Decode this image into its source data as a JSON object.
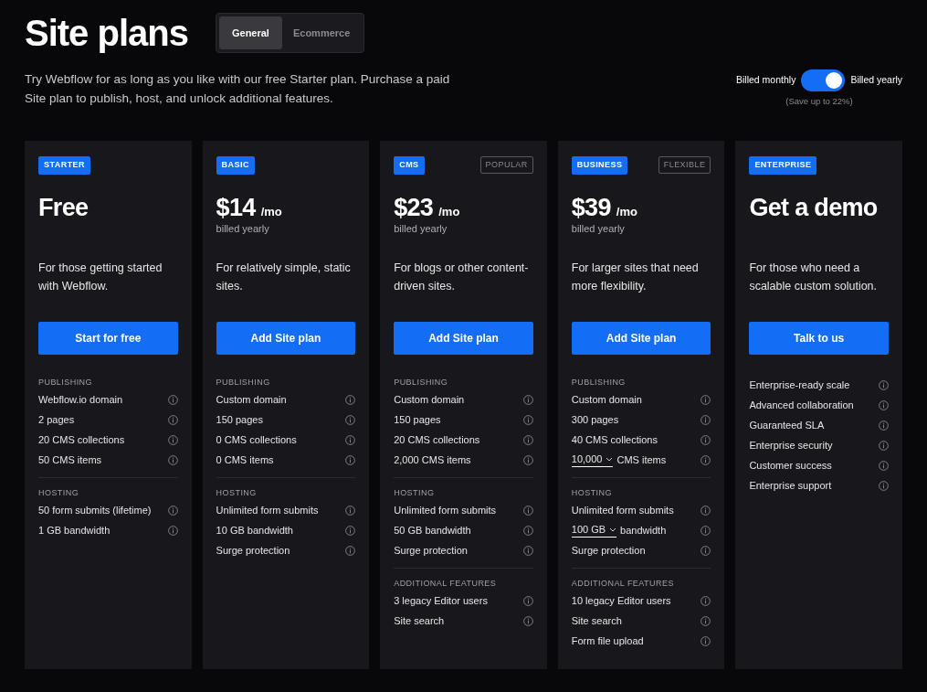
{
  "title": "Site plans",
  "tabs": [
    {
      "label": "General",
      "selected": true
    },
    {
      "label": "Ecommerce",
      "selected": false
    }
  ],
  "intro": "Try Webflow for as long as you like with our free Starter plan. Purchase a paid Site plan to publish, host, and unlock additional features.",
  "billing": {
    "left_label": "Billed monthly",
    "right_label": "Billed yearly",
    "on": true,
    "note": "(Save up to 22%)"
  },
  "plans": [
    {
      "tag": "STARTER",
      "price": "Free",
      "description": "For those getting started with Webflow.",
      "button": "Start for free",
      "sections": [
        {
          "heading": "PUBLISHING",
          "items": [
            {
              "kind": "text",
              "label": "Webflow.io domain"
            },
            {
              "kind": "text",
              "label": "2 pages"
            },
            {
              "kind": "text",
              "label": "20 CMS collections"
            },
            {
              "kind": "text",
              "label": "50 CMS items"
            }
          ]
        },
        {
          "heading": "HOSTING",
          "items": [
            {
              "kind": "text",
              "label": "50 form submits (lifetime)"
            },
            {
              "kind": "text",
              "label": "1 GB bandwidth"
            }
          ]
        }
      ]
    },
    {
      "tag": "BASIC",
      "price": "$14",
      "period": "/mo",
      "billing_note": "billed yearly",
      "description": "For relatively simple, static sites.",
      "button": "Add Site plan",
      "sections": [
        {
          "heading": "PUBLISHING",
          "items": [
            {
              "kind": "text",
              "label": "Custom domain"
            },
            {
              "kind": "text",
              "label": "150 pages"
            },
            {
              "kind": "text",
              "label": "0 CMS collections"
            },
            {
              "kind": "text",
              "label": "0 CMS items"
            }
          ]
        },
        {
          "heading": "HOSTING",
          "items": [
            {
              "kind": "text",
              "label": "Unlimited form submits"
            },
            {
              "kind": "text",
              "label": "10 GB bandwidth"
            },
            {
              "kind": "text",
              "label": "Surge protection"
            }
          ]
        }
      ]
    },
    {
      "tag": "CMS",
      "badge": "POPULAR",
      "price": "$23",
      "period": "/mo",
      "billing_note": "billed yearly",
      "description": "For blogs or other content-driven sites.",
      "button": "Add Site plan",
      "sections": [
        {
          "heading": "PUBLISHING",
          "items": [
            {
              "kind": "text",
              "label": "Custom domain"
            },
            {
              "kind": "text",
              "label": "150 pages"
            },
            {
              "kind": "text",
              "label": "20 CMS collections"
            },
            {
              "kind": "text",
              "label": "2,000 CMS items"
            }
          ]
        },
        {
          "heading": "HOSTING",
          "items": [
            {
              "kind": "text",
              "label": "Unlimited form submits"
            },
            {
              "kind": "text",
              "label": "50 GB bandwidth"
            },
            {
              "kind": "text",
              "label": "Surge protection"
            }
          ]
        },
        {
          "heading": "ADDITIONAL FEATURES",
          "items": [
            {
              "kind": "text",
              "label": "3 legacy Editor users"
            },
            {
              "kind": "text",
              "label": "Site search"
            }
          ]
        }
      ]
    },
    {
      "tag": "BUSINESS",
      "badge": "FLEXIBLE",
      "price": "$39",
      "period": "/mo",
      "billing_note": "billed yearly",
      "description": "For larger sites that need more flexibility.",
      "button": "Add Site plan",
      "sections": [
        {
          "heading": "PUBLISHING",
          "items": [
            {
              "kind": "text",
              "label": "Custom domain"
            },
            {
              "kind": "text",
              "label": "300 pages"
            },
            {
              "kind": "text",
              "label": "40 CMS collections"
            },
            {
              "kind": "select",
              "value": "10,000",
              "label": "CMS items"
            }
          ]
        },
        {
          "heading": "HOSTING",
          "items": [
            {
              "kind": "text",
              "label": "Unlimited form submits"
            },
            {
              "kind": "select",
              "value": "100 GB",
              "label": "bandwidth"
            },
            {
              "kind": "text",
              "label": "Surge protection"
            }
          ]
        },
        {
          "heading": "ADDITIONAL FEATURES",
          "items": [
            {
              "kind": "text",
              "label": "10 legacy Editor users"
            },
            {
              "kind": "text",
              "label": "Site search"
            },
            {
              "kind": "text",
              "label": "Form file upload"
            }
          ]
        }
      ]
    },
    {
      "tag": "ENTERPRISE",
      "price": "Get a demo",
      "description": "For those who need a scalable custom solution.",
      "button": "Talk to us",
      "sections": [
        {
          "items": [
            {
              "kind": "text",
              "label": "Enterprise-ready scale"
            },
            {
              "kind": "text",
              "label": "Advanced collaboration"
            },
            {
              "kind": "text",
              "label": "Guaranteed SLA"
            },
            {
              "kind": "text",
              "label": "Enterprise security"
            },
            {
              "kind": "text",
              "label": "Customer success"
            },
            {
              "kind": "text",
              "label": "Enterprise support"
            }
          ]
        }
      ]
    }
  ]
}
